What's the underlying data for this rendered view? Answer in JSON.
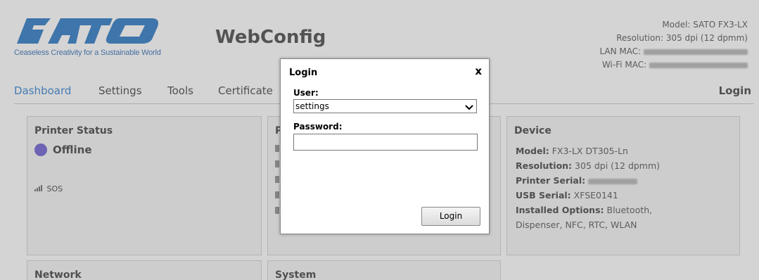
{
  "brand": {
    "tagline": "Ceaseless Creativity for a Sustainable World",
    "app_title": "WebConfig"
  },
  "device_info": {
    "model_label": "Model:",
    "model_value": "SATO FX3-LX",
    "resolution_label": "Resolution:",
    "resolution_value": "305 dpi (12 dpmm)",
    "lan_mac_label": "LAN MAC:",
    "wifi_mac_label": "Wi-Fi MAC:"
  },
  "nav": {
    "tabs": [
      "Dashboard",
      "Settings",
      "Tools",
      "Certificate"
    ],
    "login": "Login"
  },
  "panels": {
    "printer_status": {
      "title": "Printer Status",
      "status": "Offline",
      "status_color": "#7a6fd6",
      "sos": "SOS"
    },
    "middle_title_initial": "P",
    "device": {
      "title": "Device",
      "rows": [
        {
          "key": "Model:",
          "value": " FX3-LX DT305-Ln"
        },
        {
          "key": "Resolution:",
          "value": " 305 dpi (12 dpmm)"
        },
        {
          "key": "Printer Serial:",
          "value": ""
        },
        {
          "key": "USB Serial:",
          "value": " XFSE0141"
        },
        {
          "key": "Installed Options:",
          "value": " Bluetooth,"
        }
      ],
      "options_cont": "Dispenser, NFC, RTC, WLAN"
    },
    "network_title": "Network",
    "system_title": "System"
  },
  "login_dialog": {
    "title": "Login",
    "close": "x",
    "user_label": "User:",
    "user_value": "settings",
    "password_label": "Password:",
    "button": "Login"
  },
  "colors": {
    "accent": "#4a8fd6",
    "logo_blue": "#3f86c9"
  }
}
